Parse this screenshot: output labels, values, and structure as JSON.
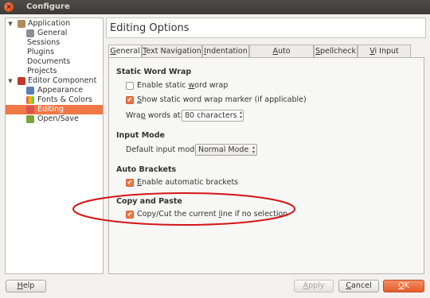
{
  "window": {
    "title": "Configure",
    "close_glyph": "×"
  },
  "tree": {
    "items": [
      {
        "label": "Application",
        "arrow": "▼",
        "icon": "application-icon"
      },
      {
        "label": "General",
        "icon": "general-icon"
      },
      {
        "label": "Sessions"
      },
      {
        "label": "Plugins"
      },
      {
        "label": "Documents"
      },
      {
        "label": "Projects"
      },
      {
        "label": "Editor Component",
        "arrow": "▼",
        "icon": "editor-icon"
      },
      {
        "label": "Appearance",
        "icon": "appearance-icon"
      },
      {
        "label": "Fonts & Colors",
        "icon": "fonts-colors-icon"
      },
      {
        "label": "Editing",
        "icon": "editing-icon",
        "selected": true
      },
      {
        "label": "Open/Save",
        "icon": "open-save-icon"
      }
    ]
  },
  "page": {
    "title": "Editing Options"
  },
  "tabs": [
    {
      "pre": "",
      "key": "G",
      "post": "eneral",
      "active": true
    },
    {
      "pre": "",
      "key": "T",
      "post": "ext Navigation"
    },
    {
      "pre": "",
      "key": "I",
      "post": "ndentation"
    },
    {
      "pre": "",
      "key": "A",
      "post": "uto Completion"
    },
    {
      "pre": "",
      "key": "S",
      "post": "pellcheck"
    },
    {
      "pre": "",
      "key": "V",
      "post": "i Input Mode"
    }
  ],
  "static_wrap": {
    "title": "Static Word Wrap",
    "enable": {
      "pre": "Enable static ",
      "key": "w",
      "post": "ord wrap",
      "checked": false
    },
    "marker": {
      "pre": "",
      "key": "S",
      "post": "how static word wrap marker (if applicable)",
      "checked": true
    },
    "wrap_label": {
      "pre": "Wra",
      "key": "p",
      "post": " words at:"
    },
    "wrap_value": "80 characters"
  },
  "input_mode": {
    "title": "Input Mode",
    "label": "Default input mode",
    "value": "Normal Mode"
  },
  "auto_brackets": {
    "title": "Auto Brackets",
    "enable": {
      "pre": "",
      "key": "E",
      "post": "nable automatic brackets",
      "checked": true
    }
  },
  "copy_paste": {
    "title": "Copy and Paste",
    "copy": {
      "pre": "Copy/Cut the current ",
      "key": "l",
      "post": "ine if no selection",
      "checked": true
    }
  },
  "buttons": {
    "help": {
      "pre": "",
      "key": "H",
      "post": "elp"
    },
    "apply": {
      "pre": "",
      "key": "A",
      "post": "pply"
    },
    "cancel": {
      "pre": "",
      "key": "C",
      "post": "ancel"
    },
    "ok": {
      "pre": "",
      "key": "O",
      "post": "K"
    }
  },
  "colors": {
    "accent": "#f07746",
    "annotation": "#d41616"
  },
  "glyphs": {
    "check": "✔",
    "up_down": "▲▼"
  }
}
